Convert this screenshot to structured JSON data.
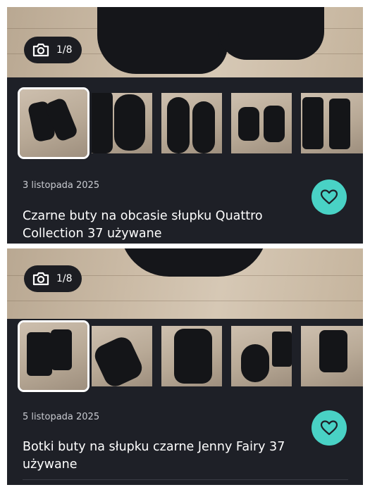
{
  "listings": [
    {
      "photo_counter": "1/8",
      "date": "3 listopada 2025",
      "title": "Czarne buty na obcasie słupku Quattro Collection 37 używane",
      "favorite_icon": "heart-icon"
    },
    {
      "photo_counter": "1/8",
      "date": "5 listopada 2025",
      "title": "Botki buty na słupku czarne Jenny Fairy 37 używane",
      "favorite_icon": "heart-icon"
    }
  ],
  "colors": {
    "card_background": "#1e2027",
    "favorite_button": "#49d2c5",
    "text_primary": "#ffffff",
    "text_secondary": "#c9cbd1"
  }
}
